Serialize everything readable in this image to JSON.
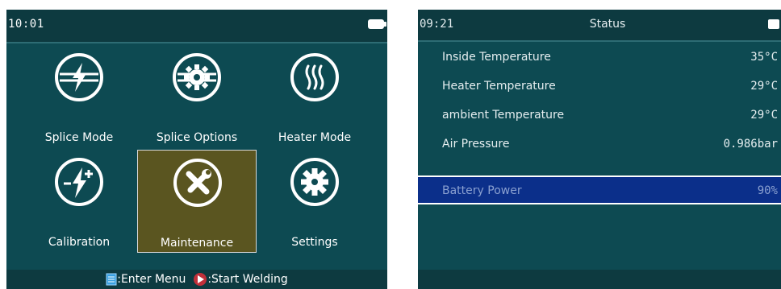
{
  "left": {
    "clock": "10:01",
    "tiles": [
      {
        "label": "Splice Mode",
        "icon": "splice-mode-icon"
      },
      {
        "label": "Splice Options",
        "icon": "gear-icon"
      },
      {
        "label": "Heater Mode",
        "icon": "heater-icon"
      },
      {
        "label": "Calibration",
        "icon": "calibration-icon"
      },
      {
        "label": "Maintenance",
        "icon": "wrench-screwdriver-icon",
        "selected": true
      },
      {
        "label": "Settings",
        "icon": "settings-gear-icon"
      }
    ],
    "footer": {
      "enter_label": ":Enter Menu",
      "start_label": ":Start Welding"
    }
  },
  "right": {
    "clock": "09:21",
    "title": "Status",
    "rows": [
      {
        "label": "Inside Temperature",
        "value": "35°C"
      },
      {
        "label": "Heater Temperature",
        "value": "29°C"
      },
      {
        "label": "ambient Temperature",
        "value": "29°C"
      },
      {
        "label": "Air Pressure",
        "value": "0.986bar"
      },
      {
        "label": "Battery Power",
        "value": "90%",
        "selected": true
      }
    ]
  },
  "colors": {
    "screen_bg": "#0d4a52",
    "bar_bg": "#0d3a40",
    "selected_tile": "#5a5520",
    "selected_row": "#0b2f8a"
  }
}
